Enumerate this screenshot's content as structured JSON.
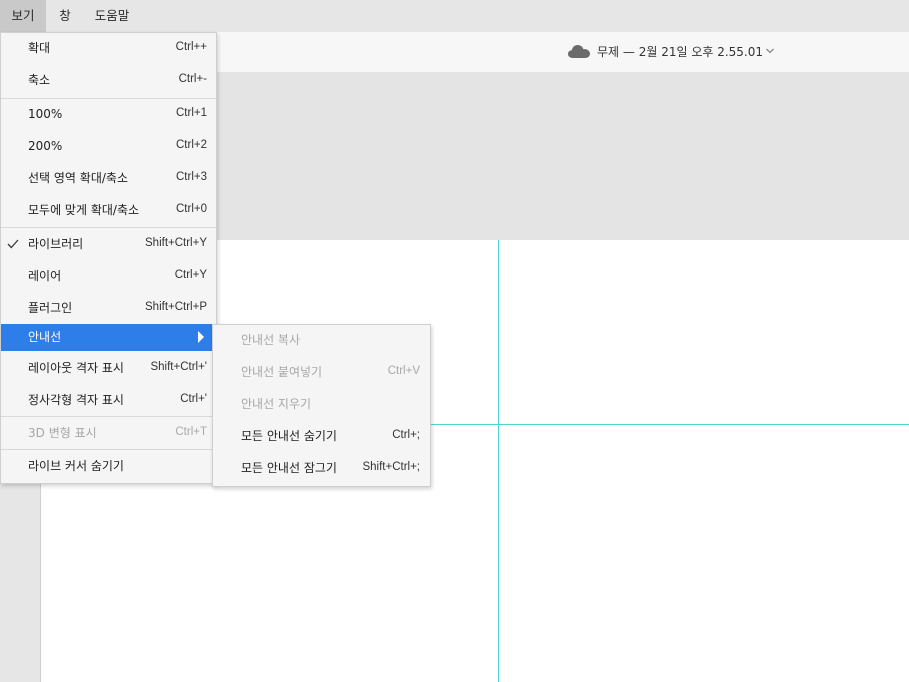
{
  "menubar": {
    "items": [
      {
        "label": "보기"
      },
      {
        "label": "창"
      },
      {
        "label": "도움말"
      }
    ]
  },
  "titlebar": {
    "cloud_icon": "cloud-icon",
    "document_title": "무제 — 2월 21일 오후 2.55.01",
    "dropdown_icon": "chevron-down-icon"
  },
  "view_menu": {
    "items": [
      {
        "label": "확대",
        "shortcut": "Ctrl++"
      },
      {
        "label": "축소",
        "shortcut": "Ctrl+-"
      },
      {
        "label": "100%",
        "shortcut": "Ctrl+1"
      },
      {
        "label": "200%",
        "shortcut": "Ctrl+2"
      },
      {
        "label": "선택 영역 확대/축소",
        "shortcut": "Ctrl+3"
      },
      {
        "label": "모두에 맞게 확대/축소",
        "shortcut": "Ctrl+0"
      },
      {
        "label": "라이브러리",
        "shortcut": "Shift+Ctrl+Y",
        "checked": true
      },
      {
        "label": "레이어",
        "shortcut": "Ctrl+Y"
      },
      {
        "label": "플러그인",
        "shortcut": "Shift+Ctrl+P"
      },
      {
        "label": "안내선",
        "highlighted": true,
        "has_submenu": true
      },
      {
        "label": "레이아웃 격자 표시",
        "shortcut": "Shift+Ctrl+'"
      },
      {
        "label": "정사각형 격자 표시",
        "shortcut": "Ctrl+'"
      },
      {
        "label": "3D 변형 표시",
        "shortcut": "Ctrl+T",
        "disabled": true
      },
      {
        "label": "라이브 커서 숨기기"
      }
    ]
  },
  "guides_submenu": {
    "items": [
      {
        "label": "안내선 복사",
        "disabled": true
      },
      {
        "label": "안내선 붙여넣기",
        "shortcut": "Ctrl+V",
        "disabled": true
      },
      {
        "label": "안내선 지우기",
        "disabled": true
      },
      {
        "label": "모든 안내선 숨기기",
        "shortcut": "Ctrl+;"
      },
      {
        "label": "모든 안내선 잠그기",
        "shortcut": "Shift+Ctrl+;"
      }
    ]
  },
  "colors": {
    "highlight": "#2d7ee8",
    "guide": "#4fd6cf",
    "menubar": "#e6e6e6",
    "menu_bg": "#f5f5f5"
  }
}
